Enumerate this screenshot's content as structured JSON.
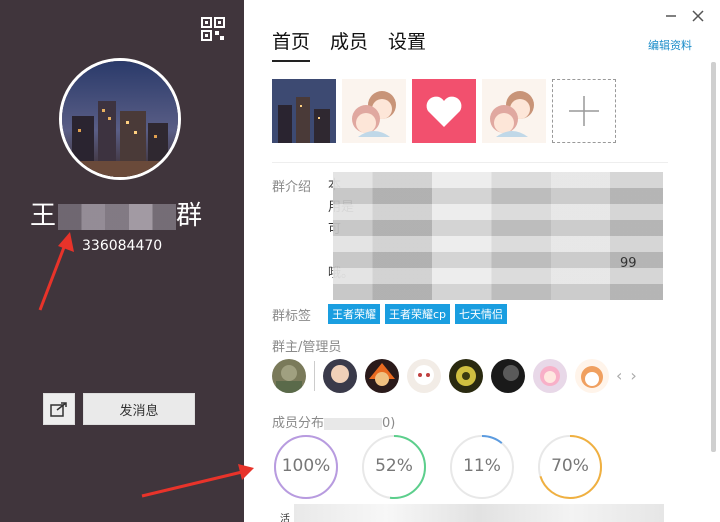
{
  "profile": {
    "name_visible_start": "王",
    "name_visible_end": "群",
    "group_id": "336084470",
    "send_message_label": "发消息"
  },
  "tabs": [
    {
      "label": "首页",
      "active": true
    },
    {
      "label": "成员",
      "active": false
    },
    {
      "label": "设置",
      "active": false
    }
  ],
  "edit_label": "编辑资料",
  "intro": {
    "label": "群介绍",
    "line1": "本",
    "line2": "用是",
    "line3": "可",
    "end_text": "99",
    "last_line": "哦。"
  },
  "tags": {
    "label": "群标签",
    "items": [
      "王者荣耀",
      "王者荣耀cp",
      "七天情侣"
    ]
  },
  "admins": {
    "label": "群主/管理员"
  },
  "distribution": {
    "label_prefix": "成员分布",
    "label_suffix": "0)",
    "items": [
      {
        "pct_text": "100%",
        "value": 1.0,
        "color": "#b89be0"
      },
      {
        "pct_text": "52%",
        "value": 0.52,
        "color": "#5ccf8c"
      },
      {
        "pct_text": "11%",
        "value": 0.11,
        "color": "#5b9be0"
      },
      {
        "pct_text": "70%",
        "value": 0.7,
        "color": "#f0b040"
      }
    ],
    "bottom_text": "活"
  },
  "colors": {
    "left_bg": "#40353c",
    "accent": "#1a8cc9",
    "tag_bg": "#1a9ee0"
  }
}
